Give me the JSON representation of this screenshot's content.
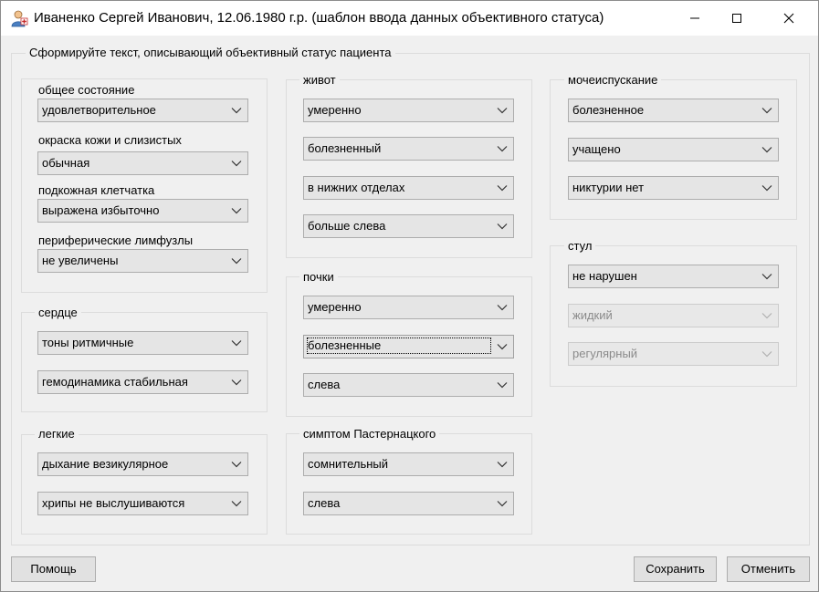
{
  "window": {
    "title": "Иваненко Сергей Иванович, 12.06.1980 г.р. (шаблон ввода данных объективного статуса)",
    "icon": "patient-icon"
  },
  "main_group": {
    "legend": "Сформируйте текст, описывающий объективный статус пациента"
  },
  "general": {
    "fields": [
      {
        "label": "общее состояние",
        "value": "удовлетворительное"
      },
      {
        "label": "окраска кожи и слизистых",
        "value": "обычная"
      },
      {
        "label": "подкожная клетчатка",
        "value": "выражена избыточно"
      },
      {
        "label": "периферические лимфузлы",
        "value": "не увеличены"
      }
    ]
  },
  "heart": {
    "legend": "сердце",
    "values": [
      "тоны ритмичные",
      "гемодинамика стабильная"
    ]
  },
  "lungs": {
    "legend": "легкие",
    "values": [
      "дыхание везикулярное",
      "хрипы не выслушиваются"
    ]
  },
  "abdomen": {
    "legend": "живот",
    "values": [
      "умеренно",
      "болезненный",
      "в нижних отделах",
      "больше слева"
    ]
  },
  "kidneys": {
    "legend": "почки",
    "values": [
      "умеренно",
      "болезненные",
      "слева"
    ]
  },
  "pasternatsky": {
    "legend": "симптом Пастернацкого",
    "values": [
      "сомнительный",
      "слева"
    ]
  },
  "urination": {
    "legend": "мочеиспускание",
    "values": [
      "болезненное",
      "учащено",
      "никтурии нет"
    ]
  },
  "stool": {
    "legend": "стул",
    "values": [
      "не нарушен",
      "жидкий",
      "регулярный"
    ]
  },
  "buttons": {
    "help": "Помощь",
    "save": "Сохранить",
    "cancel": "Отменить"
  }
}
